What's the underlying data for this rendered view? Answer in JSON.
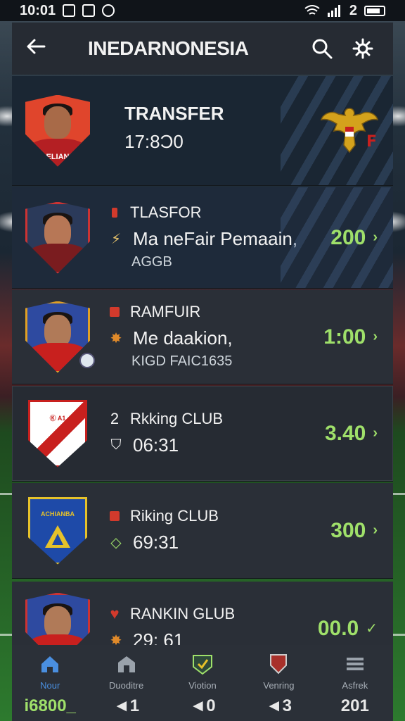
{
  "status_bar": {
    "time": "10:01",
    "battery_text": "2"
  },
  "app_bar": {
    "title": "INEDARNONESIA",
    "back_icon": "back-arrow-icon",
    "search_icon": "search-icon",
    "settings_icon": "gear-icon"
  },
  "rows": [
    {
      "kind": "header",
      "title": "TRANSFER",
      "time": "17:8Ɔ0"
    },
    {
      "line1": "TLASFOR",
      "line2": "Ma neFair Pemaain,",
      "line3": "AGGB",
      "value": "200",
      "arrow": "›"
    },
    {
      "line1": "RAMFUIR",
      "line2": "Me daakion,",
      "line3": "KIGD FAIC1635",
      "value": "1:00",
      "arrow": "›"
    },
    {
      "line1_prefix": "2",
      "line1": "Rkking CLUB",
      "line2": "06:31",
      "value": "3.40",
      "arrow": "›"
    },
    {
      "line1": "Riking CLUB",
      "line2": "69:31",
      "value": "300",
      "arrow": "›"
    },
    {
      "line1": "RANKIN GLUB",
      "line2": "29: 61",
      "value": "00.0",
      "arrow": "✓"
    }
  ],
  "crest_labels": {
    "player1_shirt": "PELIANE",
    "club1_text": "Ⓚ A1",
    "club2_text": "ACHIANBA"
  },
  "bottom_nav": [
    {
      "label": "Nour",
      "value": "i6800_",
      "icon": "home-icon"
    },
    {
      "label": "Duoditre",
      "value": "◄1",
      "icon": "store-icon"
    },
    {
      "label": "Viotion",
      "value": "◄0",
      "icon": "badge-icon"
    },
    {
      "label": "Venring",
      "value": "◄3",
      "icon": "shield-icon"
    },
    {
      "label": "Asfrek",
      "value": "201",
      "icon": "menu-icon"
    }
  ],
  "colors": {
    "accent_green": "#9fe06a",
    "accent_blue": "#4a8fe0",
    "accent_red": "#d23a2c"
  }
}
